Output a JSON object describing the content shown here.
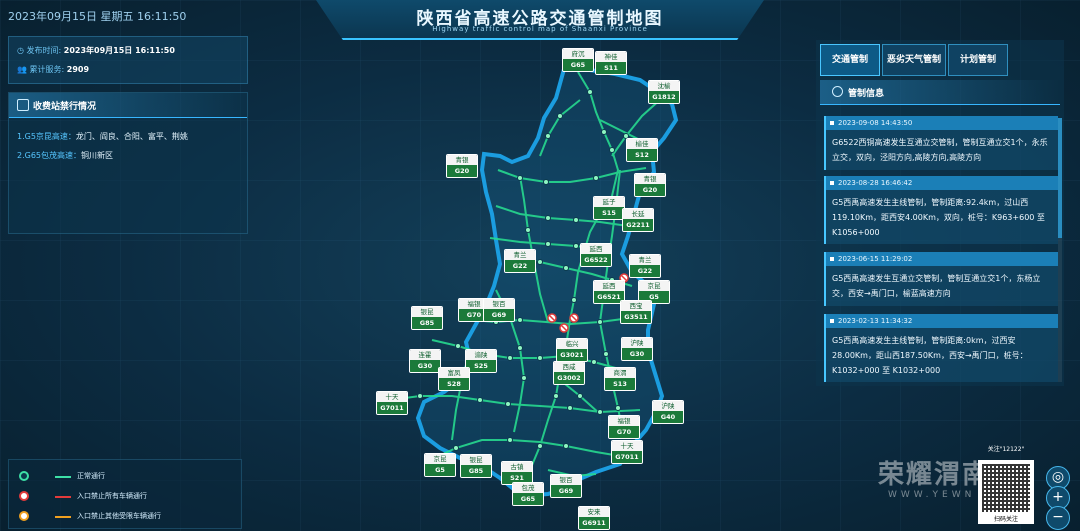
{
  "header": {
    "clock": "2023年09月15日  星期五   16:11:50",
    "title": "陕西省高速公路交通管制地图",
    "subtitle": "Highway traffic control map of Shaanxi Province"
  },
  "info": {
    "publish_label": "发布时间:",
    "publish_value": "2023年09月15日  16:11:50",
    "service_label": "累计服务:",
    "service_value": "2909"
  },
  "closures": {
    "title": "收费站禁行情况",
    "items": [
      {
        "road": "1.G5京昆高速：",
        "stations": "龙门、阎良、合阳、富平、荆姚"
      },
      {
        "road": "2.G65包茂高速：",
        "stations": "铜川新区"
      }
    ]
  },
  "legend": [
    {
      "text": "正常通行",
      "color": "#3de0a6"
    },
    {
      "text": "入口禁止所有车辆通行",
      "color": "#e23b3b"
    },
    {
      "text": "入口禁止其他受限车辆通行",
      "color": "#f0a020"
    }
  ],
  "tabs": [
    "交通管制",
    "恶劣天气管制",
    "计划管制"
  ],
  "control_head": "管制信息",
  "cards": [
    {
      "date": "2023-09-08 14:43:50",
      "text": "G6522西铜高速发生互通立交管制，管制互通立交1个，永乐立交，双向，泾阳方向,高陵方向,高陵方向"
    },
    {
      "date": "2023-08-28 16:46:42",
      "text": "G5西禹高速发生主线管制，管制距离:92.4km，过山西119.10Km，距西安4.00Km，双向，桩号：K963+600 至 K1056+000"
    },
    {
      "date": "2023-06-15 11:29:02",
      "text": "G5西禹高速发生互通立交管制，管制互通立交1个，东杨立交，西安→禹门口，榆蓝高速方向"
    },
    {
      "date": "2023-02-13 11:34:32",
      "text": "G5西禹高速发生主线管制，管制距离:0km，过西安28.00Km，距山西187.50Km，西安→禹门口，桩号：K1032+000 至 K1032+000"
    }
  ],
  "shields": [
    {
      "top": "府沉",
      "code": "G65"
    },
    {
      "top": "神佳",
      "code": "S11"
    },
    {
      "top": "沈榆",
      "code": "G1812"
    },
    {
      "top": "榆佳",
      "code": "S12"
    },
    {
      "top": "青银",
      "code": "G20"
    },
    {
      "top": "青银",
      "code": "G20"
    },
    {
      "top": "延子",
      "code": "S15"
    },
    {
      "top": "长延",
      "code": "G2211"
    },
    {
      "top": "延西",
      "code": "G6522"
    },
    {
      "top": "青兰",
      "code": "G22"
    },
    {
      "top": "青兰",
      "code": "G22"
    },
    {
      "top": "延西",
      "code": "G6521"
    },
    {
      "top": "京昆",
      "code": "G5"
    },
    {
      "top": "西宝",
      "code": "G3511"
    },
    {
      "top": "福银",
      "code": "G70"
    },
    {
      "top": "银百",
      "code": "G69"
    },
    {
      "top": "银昆",
      "code": "G85"
    },
    {
      "top": "临兴",
      "code": "G3021"
    },
    {
      "top": "沪陕",
      "code": "G30"
    },
    {
      "top": "连霍",
      "code": "G30"
    },
    {
      "top": "渝陕",
      "code": "S25"
    },
    {
      "top": "西咸",
      "code": "G3002"
    },
    {
      "top": "富凤",
      "code": "S28"
    },
    {
      "top": "商渭",
      "code": "S13"
    },
    {
      "top": "十天",
      "code": "G7011"
    },
    {
      "top": "沪陕",
      "code": "G40"
    },
    {
      "top": "福银",
      "code": "G70"
    },
    {
      "top": "十天",
      "code": "G7011"
    },
    {
      "top": "京昆",
      "code": "G5"
    },
    {
      "top": "银昆",
      "code": "G85"
    },
    {
      "top": "古镇",
      "code": "S21"
    },
    {
      "top": "包茂",
      "code": "G65"
    },
    {
      "top": "银百",
      "code": "G69"
    },
    {
      "top": "安来",
      "code": "G6911"
    }
  ],
  "watermark": "荣耀渭南",
  "watermark_sub": "WWW.YEWN",
  "qr": {
    "caption": "关注\"12122\"",
    "label": "扫码关注"
  },
  "zoom": {
    "in": "+",
    "out": "−"
  }
}
